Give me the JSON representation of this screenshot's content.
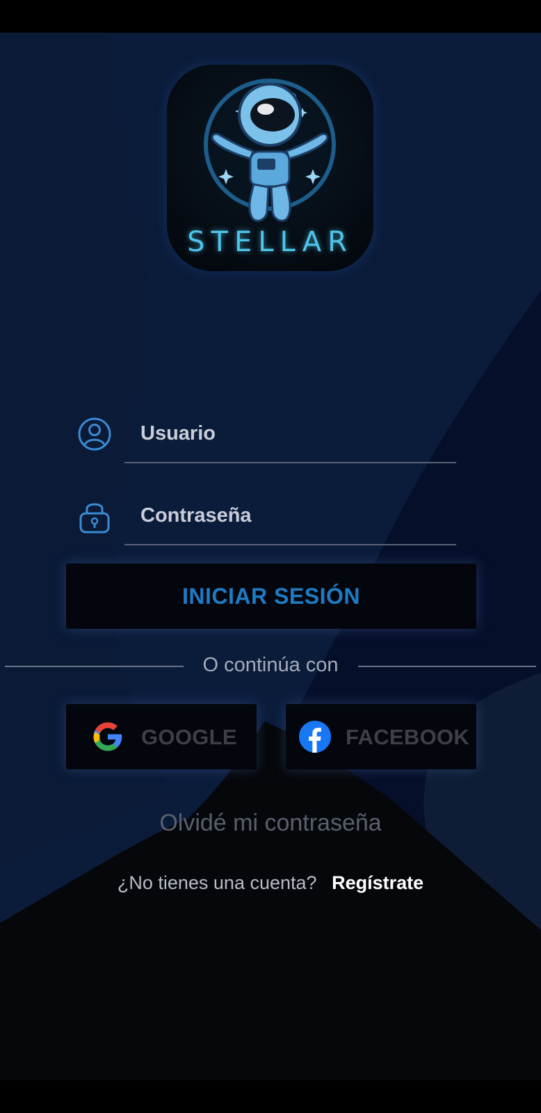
{
  "logo": {
    "text": "STELLAR",
    "accent_color": "#4fc3e8",
    "icon": "astronaut-logo"
  },
  "form": {
    "username": {
      "placeholder": "Usuario",
      "value": "",
      "icon": "user-icon"
    },
    "password": {
      "placeholder": "Contraseña",
      "value": "",
      "icon": "lock-icon"
    },
    "login_label": "INICIAR SESIÓN"
  },
  "divider": {
    "label": "O continúa con"
  },
  "social": {
    "google": {
      "label": "GOOGLE",
      "icon": "google-icon"
    },
    "facebook": {
      "label": "FACEBOOK",
      "icon": "facebook-icon"
    }
  },
  "forgot_password": "Olvidé mi contraseña",
  "register": {
    "question": "¿No tienes una cuenta?",
    "link": "Regístrate"
  },
  "colors": {
    "background_top": "#0b1c3b",
    "background_bottom": "#05070b",
    "button_text": "#1f7bc4"
  }
}
